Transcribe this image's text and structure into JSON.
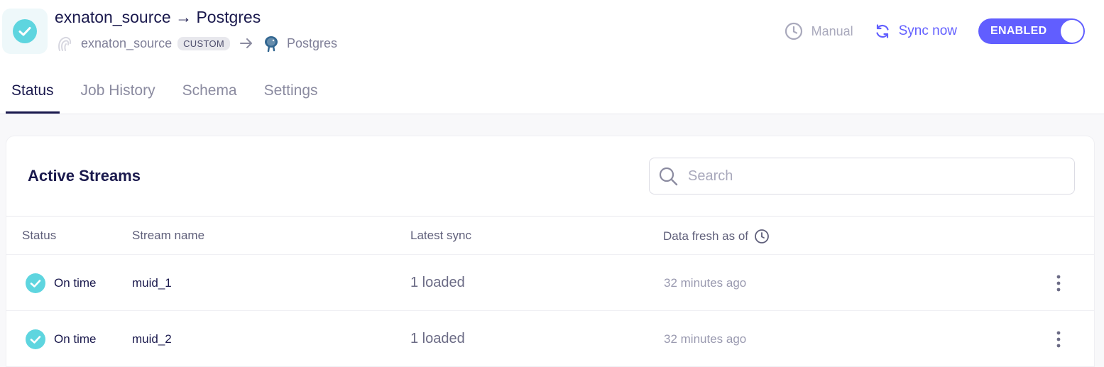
{
  "header": {
    "title": "exnaton_source → Postgres",
    "source_name": "exnaton_source",
    "source_badge": "CUSTOM",
    "destination_name": "Postgres"
  },
  "actions": {
    "schedule_label": "Manual",
    "sync_label": "Sync now",
    "toggle_label": "ENABLED"
  },
  "tabs": [
    {
      "label": "Status",
      "active": true
    },
    {
      "label": "Job History",
      "active": false
    },
    {
      "label": "Schema",
      "active": false
    },
    {
      "label": "Settings",
      "active": false
    }
  ],
  "streams_card": {
    "title": "Active Streams",
    "search_placeholder": "Search",
    "columns": {
      "status": "Status",
      "stream_name": "Stream name",
      "latest_sync": "Latest sync",
      "data_fresh": "Data fresh as of"
    },
    "rows": [
      {
        "status": "On time",
        "stream": "muid_1",
        "latest_sync": "1 loaded",
        "fresh": "32 minutes ago"
      },
      {
        "status": "On time",
        "stream": "muid_2",
        "latest_sync": "1 loaded",
        "fresh": "32 minutes ago"
      }
    ]
  },
  "colors": {
    "accent": "#615eff",
    "status_ok": "#5ed5df",
    "text_dark": "#1a194d"
  },
  "icons": {
    "connection_status": "check-circle-icon",
    "source": "custom-source-icon",
    "destination": "postgres-elephant-icon",
    "schedule": "clock-icon",
    "sync": "refresh-icon",
    "search": "search-icon",
    "freshness_info": "clock-icon",
    "row_status": "check-circle-icon",
    "row_menu": "kebab-menu-icon"
  }
}
